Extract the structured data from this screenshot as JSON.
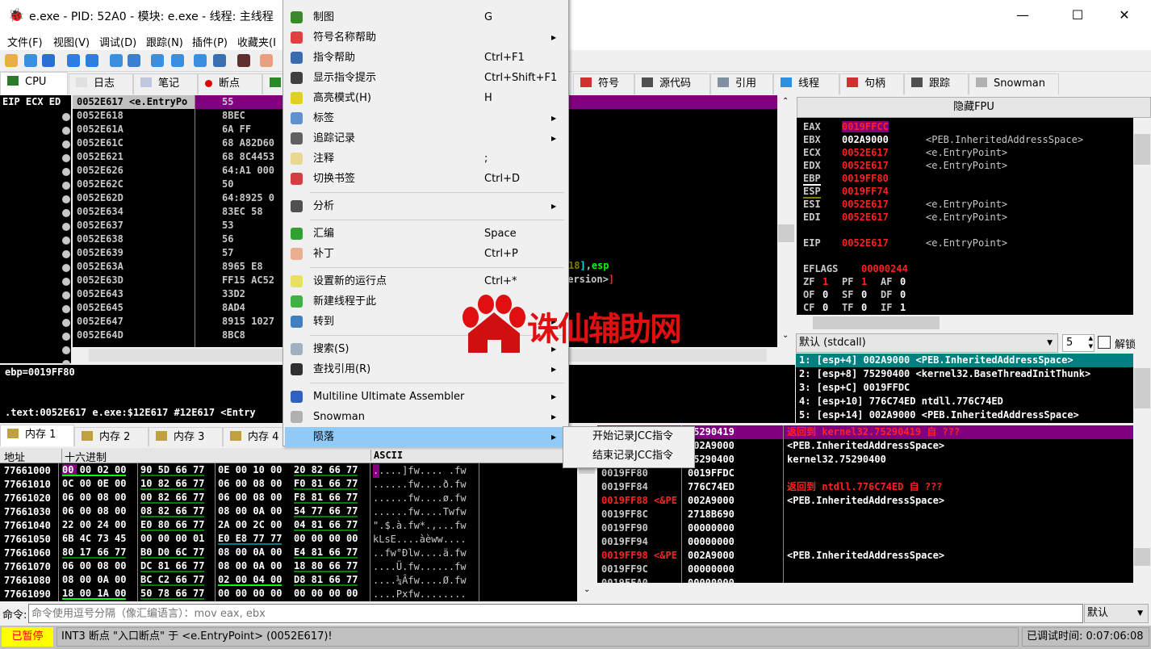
{
  "window": {
    "title": "e.exe - PID: 52A0 - 模块: e.exe - 线程: 主线程",
    "minimize": "—",
    "maximize": "☐",
    "close": "✕"
  },
  "menubar": [
    "文件(F)",
    "视图(V)",
    "调试(D)",
    "跟踪(N)",
    "插件(P)",
    "收藏夹(I"
  ],
  "toolbar_icons": [
    "open-icon",
    "restart-icon",
    "stop-icon",
    "run-icon",
    "pause-icon",
    "step-into-icon",
    "step-over-icon",
    "trace-into-icon",
    "trace-over-icon",
    "execute-till-return-icon",
    "run-to-user-code-icon",
    "scylla-icon",
    "patch-icon"
  ],
  "tabs": [
    {
      "label": "CPU",
      "icon": "cpu-icon"
    },
    {
      "label": "日志",
      "icon": "log-icon"
    },
    {
      "label": "笔记",
      "icon": "notes-icon"
    },
    {
      "label": "断点",
      "icon": "breakpoint-icon"
    },
    {
      "label": "",
      "icon": "memory-map-icon"
    },
    {
      "label": "符号",
      "icon": "symbols-icon"
    },
    {
      "label": "源代码",
      "icon": "source-icon"
    },
    {
      "label": "引用",
      "icon": "references-icon"
    },
    {
      "label": "线程",
      "icon": "threads-icon"
    },
    {
      "label": "句柄",
      "icon": "handles-icon"
    },
    {
      "label": "跟踪",
      "icon": "trace-icon"
    },
    {
      "label": "Snowman",
      "icon": "snowman-icon"
    }
  ],
  "disasm": {
    "side_label": "EIP ECX ED",
    "rows": [
      {
        "addr": "0052E617 <e.EntryPo",
        "bytes": "55"
      },
      {
        "addr": "0052E618",
        "bytes": "8BEC"
      },
      {
        "addr": "0052E61A",
        "bytes": "6A FF"
      },
      {
        "addr": "0052E61C",
        "bytes": "68 A82D60"
      },
      {
        "addr": "0052E621",
        "bytes": "68 8C4453"
      },
      {
        "addr": "0052E626",
        "bytes": "64:A1 000"
      },
      {
        "addr": "0052E62C",
        "bytes": "50"
      },
      {
        "addr": "0052E62D",
        "bytes": "64:8925 0"
      },
      {
        "addr": "0052E634",
        "bytes": "83EC 58"
      },
      {
        "addr": "0052E637",
        "bytes": "53"
      },
      {
        "addr": "0052E638",
        "bytes": "56"
      },
      {
        "addr": "0052E639",
        "bytes": "57"
      },
      {
        "addr": "0052E63A",
        "bytes": "8965 E8"
      },
      {
        "addr": "0052E63D",
        "bytes": "FF15 AC52"
      },
      {
        "addr": "0052E643",
        "bytes": "33D2"
      },
      {
        "addr": "0052E645",
        "bytes": "8AD4"
      },
      {
        "addr": "0052E647",
        "bytes": "8915 1027"
      },
      {
        "addr": "0052E64D",
        "bytes": "8BC8"
      }
    ],
    "frag1": {
      "num": "18",
      "bracket": "]",
      "comma": ",",
      "reg": "esp"
    },
    "frag2": {
      "text": "Version>",
      "bracket": "]"
    }
  },
  "info": {
    "line1": "ebp=0019FF80",
    "line2": ".text:0052E617 e.exe:$12E617 #12E617 <Entry"
  },
  "registers": {
    "header": "隐藏FPU",
    "rows": [
      {
        "name": "EAX",
        "value": "0019FFCC",
        "comment": ""
      },
      {
        "name": "EBX",
        "value": "002A9000",
        "comment": "<PEB.InheritedAddressSpace>"
      },
      {
        "name": "ECX",
        "value": "0052E617",
        "comment": "<e.EntryPoint>"
      },
      {
        "name": "EDX",
        "value": "0052E617",
        "comment": "<e.EntryPoint>"
      },
      {
        "name": "EBP",
        "value": "0019FF80",
        "comment": ""
      },
      {
        "name": "ESP",
        "value": "0019FF74",
        "comment": ""
      },
      {
        "name": "ESI",
        "value": "0052E617",
        "comment": "<e.EntryPoint>"
      },
      {
        "name": "EDI",
        "value": "0052E617",
        "comment": "<e.EntryPoint>"
      },
      {
        "name": "",
        "value": "",
        "comment": ""
      },
      {
        "name": "EIP",
        "value": "0052E617",
        "comment": "<e.EntryPoint>"
      }
    ],
    "eflags": {
      "name": "EFLAGS",
      "value": "00000244"
    },
    "flags": [
      [
        [
          "ZF",
          "1"
        ],
        [
          "PF",
          "1"
        ],
        [
          "AF",
          "0"
        ]
      ],
      [
        [
          "OF",
          "0"
        ],
        [
          "SF",
          "0"
        ],
        [
          "DF",
          "0"
        ]
      ],
      [
        [
          "CF",
          "0"
        ],
        [
          "TF",
          "0"
        ],
        [
          "IF",
          "1"
        ]
      ]
    ]
  },
  "callconv": {
    "selected": "默认 (stdcall)",
    "count": "5",
    "unlock_label": "解锁",
    "unlock_checked": false
  },
  "args": [
    "1: [esp+4] 002A9000 <PEB.InheritedAddressSpace>",
    "2: [esp+8] 75290400 <kernel32.BaseThreadInitThunk>",
    "3: [esp+C] 0019FFDC",
    "4: [esp+10] 776C74ED ntdll.776C74ED",
    "5: [esp+14] 002A9000 <PEB.InheritedAddressSpace>"
  ],
  "memtabs": [
    "内存 1",
    "内存 2",
    "内存 3",
    "内存 4"
  ],
  "dump": {
    "headers": {
      "addr": "地址",
      "hex": "十六进制",
      "ascii": "ASCII"
    },
    "rows": [
      {
        "addr": "77661000",
        "hex": [
          "00 00 02 00",
          "90 5D 66 77",
          "0E 00 10 00",
          "20 82 66 77"
        ],
        "ascii": ".....]fw.... .fw"
      },
      {
        "addr": "77661010",
        "hex": [
          "0C 00 0E 00",
          "10 82 66 77",
          "06 00 08 00",
          "F0 81 66 77"
        ],
        "ascii": "......fw....ð.fw"
      },
      {
        "addr": "77661020",
        "hex": [
          "06 00 08 00",
          "00 82 66 77",
          "06 00 08 00",
          "F8 81 66 77"
        ],
        "ascii": "......fw....ø.fw"
      },
      {
        "addr": "77661030",
        "hex": [
          "06 00 08 00",
          "08 82 66 77",
          "08 00 0A 00",
          "54 77 66 77"
        ],
        "ascii": "......fw....Twfw"
      },
      {
        "addr": "77661040",
        "hex": [
          "22 00 24 00",
          "E0 80 66 77",
          "2A 00 2C 00",
          "04 81 66 77"
        ],
        "ascii": "\".$.à.fw*.,...fw"
      },
      {
        "addr": "77661050",
        "hex": [
          "6B 4C 73 45",
          "00 00 00 01",
          "E0 E8 77 77",
          "00 00 00 00"
        ],
        "ascii": "kLsE....àèww...."
      },
      {
        "addr": "77661060",
        "hex": [
          "80 17 66 77",
          "B0 D0 6C 77",
          "08 00 0A 00",
          "E4 81 66 77"
        ],
        "ascii": "..fw°Ðlw....ä.fw"
      },
      {
        "addr": "77661070",
        "hex": [
          "06 00 08 00",
          "DC 81 66 77",
          "08 00 0A 00",
          "18 80 66 77"
        ],
        "ascii": "....Ü.fw......fw"
      },
      {
        "addr": "77661080",
        "hex": [
          "08 00 0A 00",
          "BC C2 66 77",
          "02 00 04 00",
          "D8 81 66 77"
        ],
        "ascii": "....¼Âfw....Ø.fw"
      },
      {
        "addr": "77661090",
        "hex": [
          "18 00 1A 00",
          "50 78 66 77",
          "00 00 00 00",
          "00 00 00 00"
        ],
        "ascii": "....Pxfw........"
      }
    ]
  },
  "stack": {
    "rows": [
      {
        "addr": "0019FF74",
        "value": "75290419",
        "comment": "返回到 kernel32.75290419 自 ???",
        "red": true
      },
      {
        "addr": "0019FF78",
        "value": "002A9000",
        "comment": "<PEB.InheritedAddressSpace>"
      },
      {
        "addr": "0019FF7C",
        "value": "75290400",
        "comment": "kernel32.75290400"
      },
      {
        "addr": "0019FF80",
        "value": "0019FFDC",
        "comment": ""
      },
      {
        "addr": "0019FF84",
        "value": "776C74ED",
        "comment": "返回到 ntdll.776C74ED 自 ???",
        "red": true
      },
      {
        "addr": "0019FF88 <&PE",
        "value": "002A9000",
        "comment": "<PEB.InheritedAddressSpace>",
        "redaddr": true
      },
      {
        "addr": "0019FF8C",
        "value": "2718B690",
        "comment": ""
      },
      {
        "addr": "0019FF90",
        "value": "00000000",
        "comment": ""
      },
      {
        "addr": "0019FF94",
        "value": "00000000",
        "comment": ""
      },
      {
        "addr": "0019FF98 <&PE",
        "value": "002A9000",
        "comment": "<PEB.InheritedAddressSpace>",
        "redaddr": true
      },
      {
        "addr": "0019FF9C",
        "value": "00000000",
        "comment": ""
      },
      {
        "addr": "0019FFA0",
        "value": "00000000",
        "comment": ""
      }
    ]
  },
  "context_menu": {
    "items": [
      {
        "label": "制图",
        "shortcut": "G",
        "icon": "graph-icon",
        "color": "#3a8a2a"
      },
      {
        "label": "符号名称帮助",
        "submenu": true,
        "icon": "lifebuoy-icon",
        "color": "#e04040"
      },
      {
        "label": "指令帮助",
        "shortcut": "Ctrl+F1",
        "icon": "help-book-icon",
        "color": "#3a6ab0"
      },
      {
        "label": "显示指令提示",
        "shortcut": "Ctrl+Shift+F1",
        "icon": "penguin-icon",
        "color": "#404040"
      },
      {
        "label": "高亮模式(H)",
        "shortcut": "H",
        "icon": "highlighter-icon",
        "color": "#e0d020"
      },
      {
        "label": "标签",
        "submenu": true,
        "icon": "label-icon",
        "color": "#6090d0"
      },
      {
        "label": "追踪记录",
        "submenu": true,
        "icon": "footprints-icon",
        "color": "#606060"
      },
      {
        "label": "注释",
        "shortcut": ";",
        "icon": "comment-icon",
        "color": "#e8d890"
      },
      {
        "label": "切换书签",
        "shortcut": "Ctrl+D",
        "icon": "bookmark-icon",
        "color": "#d04040",
        "sep_after": true
      },
      {
        "label": "分析",
        "submenu": true,
        "icon": "wand-icon",
        "color": "#505050",
        "sep_after": true
      },
      {
        "label": "汇编",
        "shortcut": "Space",
        "icon": "assemble-icon",
        "color": "#30a030"
      },
      {
        "label": "补丁",
        "shortcut": "Ctrl+P",
        "icon": "patch-icon",
        "color": "#e8b090",
        "sep_after": true
      },
      {
        "label": "设置新的运行点",
        "shortcut": "Ctrl+*",
        "icon": "new-origin-icon",
        "color": "#e8e060"
      },
      {
        "label": "新建线程于此",
        "icon": "new-thread-icon",
        "color": "#40b040"
      },
      {
        "label": "转到",
        "submenu": true,
        "icon": "goto-car-icon",
        "color": "#4080c0",
        "sep_after": true
      },
      {
        "label": "搜索(S)",
        "submenu": true,
        "icon": "search-icon",
        "color": "#a0b0c0"
      },
      {
        "label": "查找引用(R)",
        "submenu": true,
        "icon": "binoculars-icon",
        "color": "#303030",
        "sep_after": true
      },
      {
        "label": "Multiline Ultimate Assembler",
        "submenu": true,
        "icon": "mua-icon",
        "color": "#3060c0"
      },
      {
        "label": "Snowman",
        "submenu": true,
        "icon": "snowman-icon",
        "color": "#b0b0b0"
      },
      {
        "label": "陨落",
        "submenu": true,
        "highlighted": true,
        "icon": "",
        "color": ""
      }
    ]
  },
  "submenu": [
    "开始记录JCC指令",
    "结束记录JCC指令"
  ],
  "command": {
    "label": "命令:",
    "placeholder": "命令使用逗号分隔（像汇编语言）：mov eax, ebx",
    "mode": "默认"
  },
  "status": {
    "state": "已暂停",
    "message": "INT3 断点 \"入口断点\" 于 <e.EntryPoint> (0052E617)!",
    "time_label": "已调试时间:",
    "time": "0:07:06:08"
  },
  "watermark": {
    "text": "诛仙辅助网",
    "color": "#e01010"
  },
  "colors": {
    "selection": "#800080",
    "accent_red": "#ff2020",
    "highlight": "#91c9f7",
    "arg_selected": "#008080",
    "paused": "#ffff00"
  }
}
